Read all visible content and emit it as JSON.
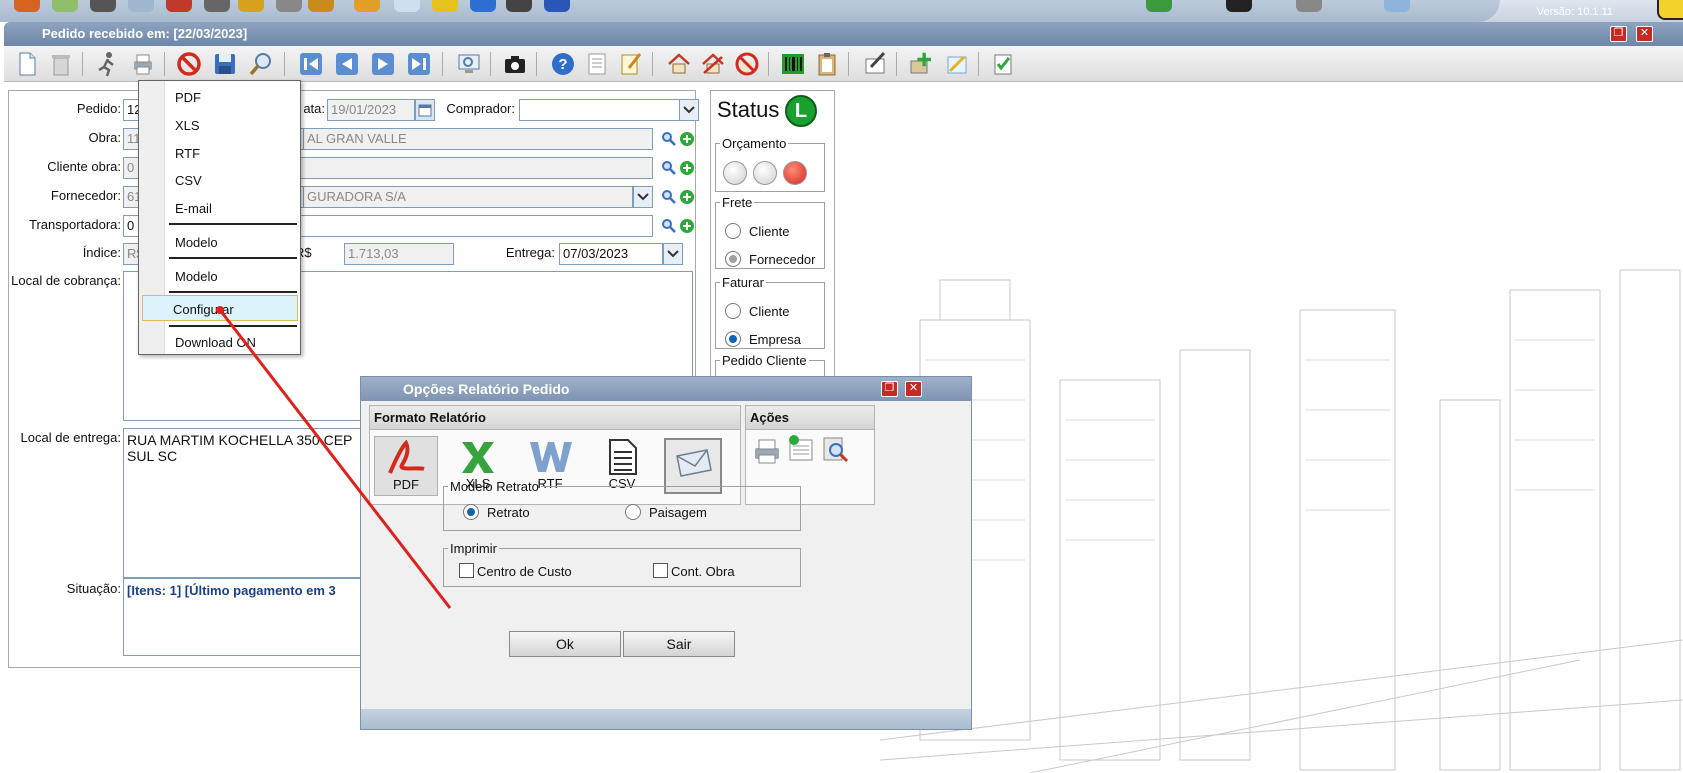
{
  "window": {
    "title": "Pedido recebido em: [22/03/2023]",
    "version": "Versão: 10.1.11"
  },
  "form": {
    "pedido_label": "Pedido:",
    "pedido_value": "129",
    "data_label": "ata:",
    "data_value": "19/01/2023",
    "comprador_label": "Comprador:",
    "comprador_value": "",
    "obra_label": "Obra:",
    "obra_value": "116",
    "obra_name": "AL GRAN VALLE",
    "cliente_obra_label": "Cliente obra:",
    "cliente_obra_value": "0",
    "fornecedor_label": "Fornecedor:",
    "fornecedor_value": "61",
    "fornecedor_name": "GURADORA S/A",
    "transportadora_label": "Transportadora:",
    "transportadora_value": "0",
    "indice_label": "Índice:",
    "indice_value": "R$",
    "valor_prefix": "R$",
    "valor_value": "1.713,03",
    "entrega_label": "Entrega:",
    "entrega_value": "07/03/2023",
    "local_cobranca_label": "Local de cobrança:",
    "local_entrega_label": "Local de entrega:",
    "local_entrega_value": "RUA MARTIM KOCHELLA 350 CEP",
    "local_entrega_value2": "SUL SC",
    "situacao_label": "Situação:",
    "situacao_value": "[Itens: 1] [Último pagamento em 3"
  },
  "status": {
    "title": "Status",
    "badge": "L",
    "orcamento_legend": "Orçamento",
    "frete_legend": "Frete",
    "frete_options": [
      "Cliente",
      "Fornecedor"
    ],
    "frete_selected": "Fornecedor",
    "faturar_legend": "Faturar",
    "faturar_options": [
      "Cliente",
      "Empresa"
    ],
    "faturar_selected": "Empresa",
    "pedido_cliente_legend": "Pedido Cliente"
  },
  "print_menu": {
    "items": [
      "PDF",
      "XLS",
      "RTF",
      "CSV",
      "E-mail",
      "Modelo",
      "Modelo",
      "Configurar",
      "Download ON"
    ],
    "highlighted": "Configurar"
  },
  "dialog": {
    "title": "Opções Relatório Pedido",
    "formato_header": "Formato Relatório",
    "formats": [
      "PDF",
      "XLS",
      "RTF",
      "CSV"
    ],
    "selected_format": "PDF",
    "acoes_header": "Ações",
    "modelo_legend": "Modelo Retrato",
    "modelo_options": [
      "Retrato",
      "Paisagem"
    ],
    "modelo_selected": "Retrato",
    "imprimir_legend": "Imprimir",
    "imprimir_options": [
      "Centro de Custo",
      "Cont. Obra"
    ],
    "ok_label": "Ok",
    "sair_label": "Sair"
  },
  "colors": {
    "title_bar": "#6e86a8",
    "accent_red": "#d42a1e",
    "status_green": "#19a12f",
    "link_blue": "#1a3e8a"
  }
}
